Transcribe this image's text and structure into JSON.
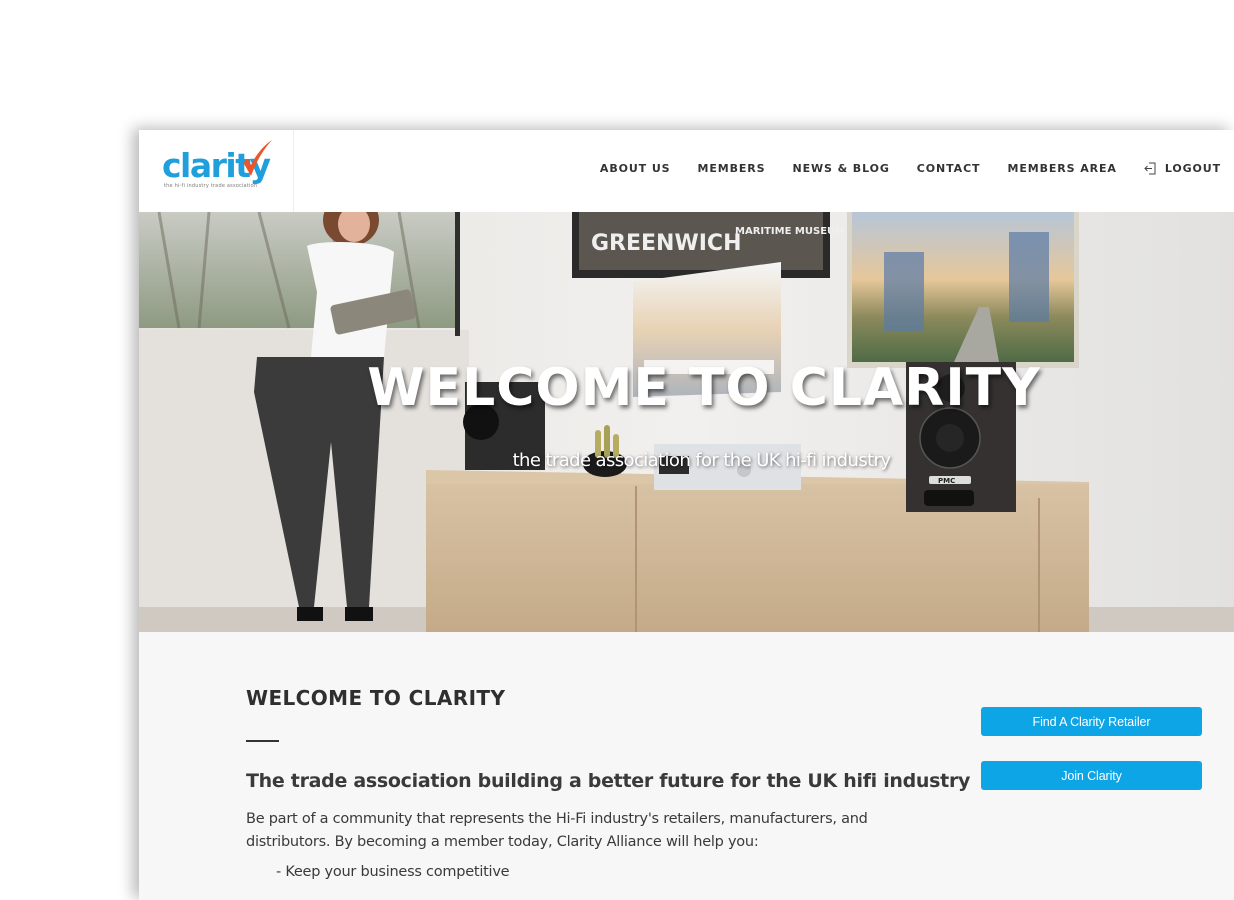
{
  "header": {
    "logo": {
      "wordmark": "clarity",
      "tagline": "the hi-fi industry trade association",
      "brand_color": "#1fa0dc",
      "check_color": "#e8562a"
    },
    "nav": [
      {
        "label": "ABOUT US"
      },
      {
        "label": "MEMBERS"
      },
      {
        "label": "NEWS & BLOG"
      },
      {
        "label": "CONTACT"
      },
      {
        "label": "MEMBERS AREA"
      },
      {
        "label": "LOGOUT",
        "icon": "logout-icon"
      }
    ]
  },
  "hero": {
    "title": "WELCOME TO CLARITY",
    "subtitle": "the trade association for the UK hi-fi industry",
    "image_alt": "Woman with tablet leaning on wall beside a wooden sideboard with speakers and framed Greenwich prints",
    "poster_text": "GREENWICH",
    "poster_subtext": "MARITIME MUSEUM",
    "speaker_badge": "PMC"
  },
  "main": {
    "title": "WELCOME TO CLARITY",
    "lead": "The trade association building a better future for the UK hifi industry",
    "body": "Be part of a community that represents the Hi-Fi industry's retailers, manufacturers, and distributors. By becoming a member today, Clarity Alliance will help you:",
    "bullets": [
      "- Keep your business competitive"
    ],
    "buttons": {
      "find_retailer": "Find A Clarity Retailer",
      "join": "Join Clarity"
    },
    "button_color": "#0ea5e6"
  }
}
